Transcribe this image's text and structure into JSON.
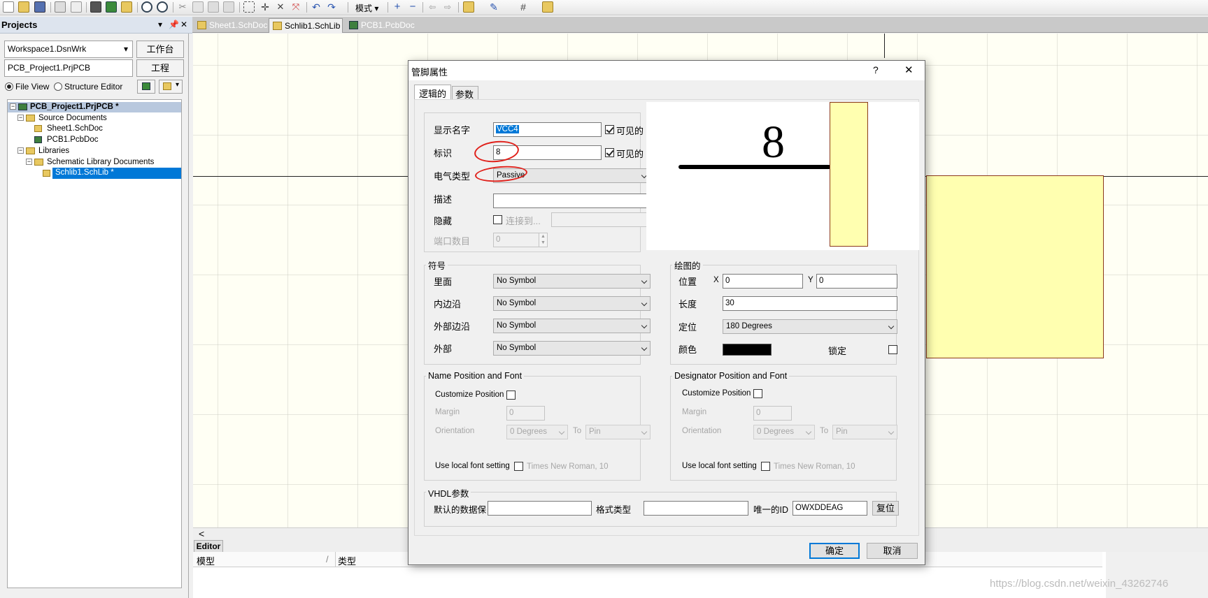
{
  "toolbar": {
    "mode_label": "模式"
  },
  "projects": {
    "title": "Projects",
    "workspace": "Workspace1.DsnWrk",
    "workspace_btn": "工作台",
    "project": "PCB_Project1.PrjPCB",
    "project_btn": "工程",
    "file_view": "File View",
    "structure_editor": "Structure Editor",
    "tree": {
      "root": "PCB_Project1.PrjPCB *",
      "source_docs": "Source Documents",
      "sheet1": "Sheet1.SchDoc",
      "pcb1": "PCB1.PcbDoc",
      "libraries": "Libraries",
      "sch_lib_docs": "Schematic Library Documents",
      "schlib": "Schlib1.SchLib *"
    }
  },
  "tabs": [
    {
      "label": "Sheet1.SchDoc"
    },
    {
      "label": "Schlib1.SchLib *"
    },
    {
      "label": "PCB1.PcbDoc"
    }
  ],
  "editor": {
    "panel_label": "Editor",
    "col_model": "模型",
    "col_type": "类型",
    "scroll_left": "<"
  },
  "dialog": {
    "title": "管脚属性",
    "help": "?",
    "close": "✕",
    "tab_logical": "逻辑的",
    "tab_params": "参数",
    "display_name_label": "显示名字",
    "display_name_value": "VCC4",
    "visible_label": "可见的",
    "designator_label": "标识",
    "designator_value": "8",
    "elec_type_label": "电气类型",
    "elec_type_value": "Passive",
    "description_label": "描述",
    "description_value": "",
    "hidden_label": "隐藏",
    "connect_to_label": "连接到...",
    "port_count_label": "端口数目",
    "port_count_value": "0",
    "preview_number": "8",
    "symbols": {
      "title": "符号",
      "inside_label": "里面",
      "inside_edge_label": "内边沿",
      "outside_edge_label": "外部边沿",
      "outside_label": "外部",
      "value": "No Symbol"
    },
    "graphical": {
      "title": "绘图的",
      "location_label": "位置",
      "x_label": "X",
      "x_value": "0",
      "y_label": "Y",
      "y_value": "0",
      "length_label": "长度",
      "length_value": "30",
      "orientation_label": "定位",
      "orientation_value": "180 Degrees",
      "color_label": "颜色",
      "color_value": "#000000",
      "locked_label": "锁定"
    },
    "name_pos": {
      "title": "Name Position and Font",
      "customize": "Customize Position",
      "margin_label": "Margin",
      "margin_value": "0",
      "orientation_label": "Orientation",
      "orientation_value": "0 Degrees",
      "to_label": "To",
      "to_value": "Pin",
      "font_label": "Use local font setting",
      "font_value": "Times New Roman, 10"
    },
    "desig_pos": {
      "title": "Designator Position and Font",
      "customize": "Customize Position",
      "margin_label": "Margin",
      "margin_value": "0",
      "orientation_label": "Orientation",
      "orientation_value": "0 Degrees",
      "to_label": "To",
      "to_value": "Pin",
      "font_label": "Use local font setting",
      "font_value": "Times New Roman, 10"
    },
    "vhdl": {
      "title": "VHDL参数",
      "default_label": "默认的数据保",
      "format_label": "格式类型",
      "uid_label": "唯一的ID",
      "uid_value": "OWXDDEAG",
      "reset_btn": "复位"
    },
    "ok_btn": "确定",
    "cancel_btn": "取消"
  },
  "watermark": "https://blog.csdn.net/weixin_43262746"
}
